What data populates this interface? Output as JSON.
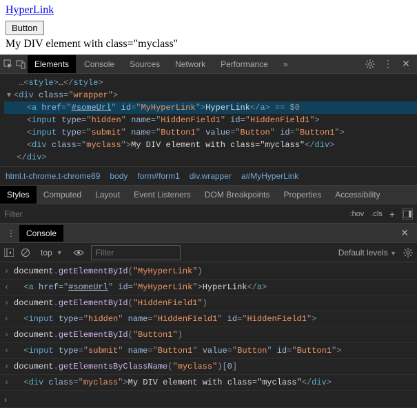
{
  "page": {
    "link_text": "HyperLink",
    "link_href": "#someUrl",
    "button_label": "Button",
    "div_text": "My DIV element with class=\"myclass\""
  },
  "tabs": {
    "elements": "Elements",
    "console": "Console",
    "sources": "Sources",
    "network": "Network",
    "performance": "Performance"
  },
  "elements_source": {
    "l0": "<style>…</style>",
    "l1_open": "<div class=\"wrapper\">",
    "l2_tag": "a",
    "l2_href_n": "href",
    "l2_href_v": "#someUrl",
    "l2_id_n": "id",
    "l2_id_v": "MyHyperLink",
    "l2_text": "HyperLink",
    "l2_selmark": " == $0",
    "l3_tag": "input",
    "l3_type_n": "type",
    "l3_type_v": "hidden",
    "l3_name_n": "name",
    "l3_name_v": "HiddenField1",
    "l3_id_n": "id",
    "l3_id_v": "HiddenField1",
    "l4_tag": "input",
    "l4_type_n": "type",
    "l4_type_v": "submit",
    "l4_name_n": "name",
    "l4_name_v": "Button1",
    "l4_val_n": "value",
    "l4_val_v": "Button",
    "l4_id_n": "id",
    "l4_id_v": "Button1",
    "l5_tag": "div",
    "l5_cls_n": "class",
    "l5_cls_v": "myclass",
    "l5_text": "My DIV element with class=\"myclass\"",
    "l6_close": "</div>"
  },
  "breadcrumbs": [
    "html.t-chrome.t-chrome89",
    "body",
    "form#form1",
    "div.wrapper",
    "a#MyHyperLink"
  ],
  "styles_tabs": [
    "Styles",
    "Computed",
    "Layout",
    "Event Listeners",
    "DOM Breakpoints",
    "Properties",
    "Accessibility"
  ],
  "filter": {
    "placeholder": "Filter",
    "hov": ":hov",
    "cls": ".cls"
  },
  "drawer": {
    "tab": "Console",
    "context": "top",
    "filter_placeholder": "Filter",
    "levels": "Default levels"
  },
  "console_entries": [
    {
      "dir": "in",
      "expr": [
        "document.",
        "getElementById",
        "(",
        "\"MyHyperLink\"",
        ")"
      ]
    },
    {
      "dir": "out",
      "html": {
        "tag": "a",
        "attrs": [
          [
            "href",
            "#someUrl",
            true
          ],
          [
            "id",
            "MyHyperLink",
            false
          ]
        ],
        "text": "HyperLink",
        "close": true
      }
    },
    {
      "dir": "in",
      "expr": [
        "document.",
        "getElementById",
        "(",
        "\"HiddenField1\"",
        ")"
      ]
    },
    {
      "dir": "out",
      "html": {
        "tag": "input",
        "attrs": [
          [
            "type",
            "hidden",
            false
          ],
          [
            "name",
            "HiddenField1",
            false
          ],
          [
            "id",
            "HiddenField1",
            false
          ]
        ],
        "self_close": true
      }
    },
    {
      "dir": "in",
      "expr": [
        "document.",
        "getElementById",
        "(",
        "\"Button1\"",
        ")"
      ]
    },
    {
      "dir": "out",
      "html": {
        "tag": "input",
        "attrs": [
          [
            "type",
            "submit",
            false
          ],
          [
            "name",
            "Button1",
            false
          ],
          [
            "value",
            "Button",
            false
          ],
          [
            "id",
            "Button1",
            false
          ]
        ],
        "self_close": true
      }
    },
    {
      "dir": "in",
      "expr": [
        "document.",
        "getElementsByClassName",
        "(",
        "\"myclass\"",
        ")[",
        "0",
        "]"
      ]
    },
    {
      "dir": "out",
      "html": {
        "tag": "div",
        "attrs": [
          [
            "class",
            "myclass",
            false
          ]
        ],
        "text": "My DIV element with class=\"myclass\"",
        "close": true
      }
    }
  ]
}
